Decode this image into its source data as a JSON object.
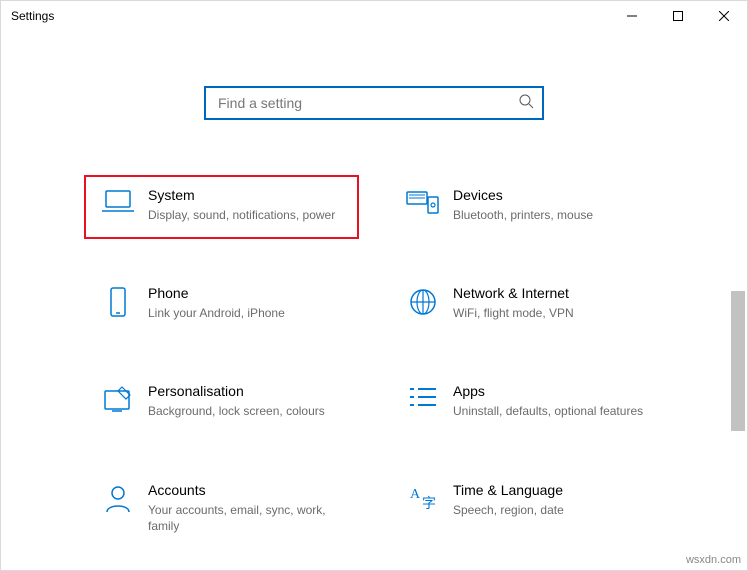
{
  "window": {
    "title": "Settings"
  },
  "search": {
    "placeholder": "Find a setting"
  },
  "tiles": {
    "system": {
      "title": "System",
      "desc": "Display, sound, notifications, power"
    },
    "devices": {
      "title": "Devices",
      "desc": "Bluetooth, printers, mouse"
    },
    "phone": {
      "title": "Phone",
      "desc": "Link your Android, iPhone"
    },
    "network": {
      "title": "Network & Internet",
      "desc": "WiFi, flight mode, VPN"
    },
    "personalisation": {
      "title": "Personalisation",
      "desc": "Background, lock screen, colours"
    },
    "apps": {
      "title": "Apps",
      "desc": "Uninstall, defaults, optional features"
    },
    "accounts": {
      "title": "Accounts",
      "desc": "Your accounts, email, sync, work, family"
    },
    "time": {
      "title": "Time & Language",
      "desc": "Speech, region, date"
    }
  },
  "watermark": "wsxdn.com"
}
